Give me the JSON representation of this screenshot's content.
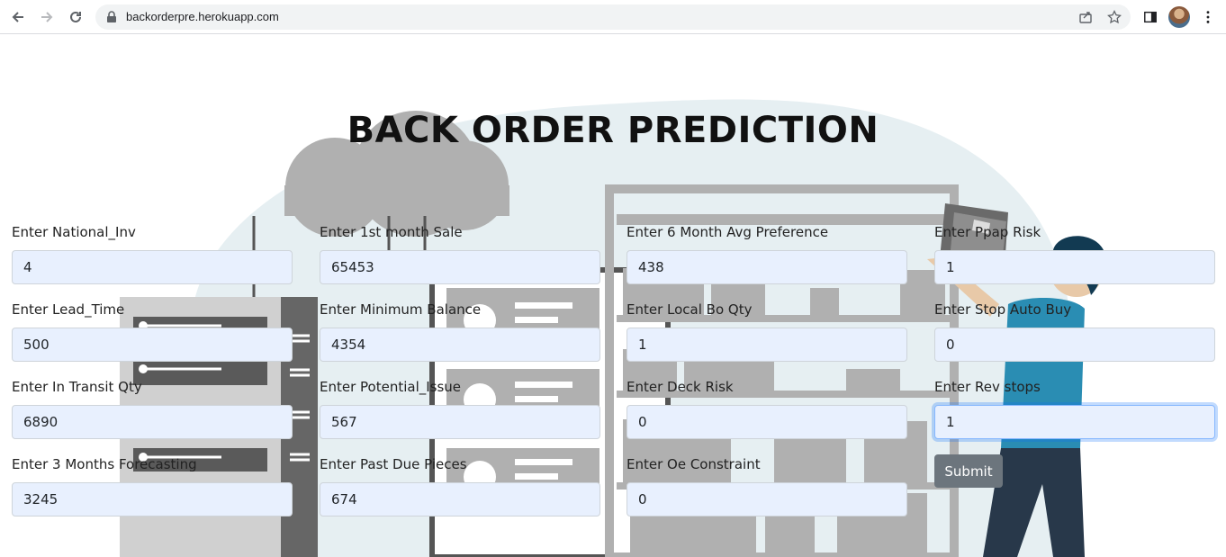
{
  "browser": {
    "url": "backorderpre.herokuapp.com",
    "icons": {
      "back": "arrow-left-icon",
      "forward": "arrow-right-icon",
      "reload": "reload-icon",
      "lock": "lock-icon",
      "share": "share-icon",
      "bookmark": "star-icon",
      "sidepanel": "side-panel-icon",
      "menu": "kebab-menu-icon"
    }
  },
  "page": {
    "title": "BACK ORDER PREDICTION",
    "submit_label": "Submit",
    "fields": [
      {
        "label": "Enter National_Inv",
        "value": "4"
      },
      {
        "label": "Enter 1st month Sale",
        "value": "65453"
      },
      {
        "label": "Enter 6 Month Avg Preference",
        "value": "438"
      },
      {
        "label": "Enter Ppap Risk",
        "value": "1"
      },
      {
        "label": "Enter Lead_Time",
        "value": "500"
      },
      {
        "label": "Enter Minimum Balance",
        "value": "4354"
      },
      {
        "label": "Enter Local Bo Qty",
        "value": "1"
      },
      {
        "label": "Enter Stop Auto Buy",
        "value": "0"
      },
      {
        "label": "Enter In Transit Qty",
        "value": "6890"
      },
      {
        "label": "Enter Potential_Issue",
        "value": "567"
      },
      {
        "label": "Enter Deck Risk",
        "value": "0"
      },
      {
        "label": "Enter Rev stops",
        "value": "1"
      },
      {
        "label": "Enter 3 Months Forecasting",
        "value": "3245"
      },
      {
        "label": "Enter Past Due Pieces",
        "value": "674"
      },
      {
        "label": "Enter Oe Constraint",
        "value": "0"
      }
    ]
  },
  "colors": {
    "input_bg": "#e8f0fe",
    "button_bg": "#6c757d",
    "art_gray": "#b0b0b0",
    "art_blob": "#e6eff2"
  }
}
